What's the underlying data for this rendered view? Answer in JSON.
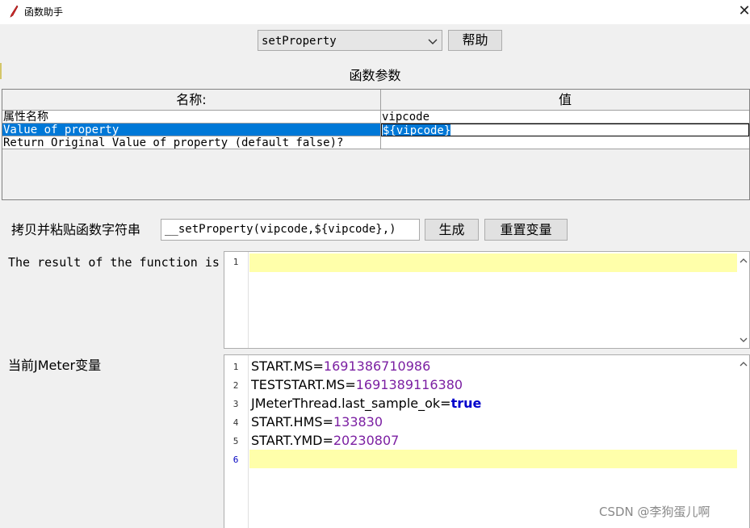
{
  "window": {
    "title": "函数助手",
    "app_icon": "feather-pen-icon",
    "close_icon": "close-icon"
  },
  "function_select": {
    "value": "setProperty",
    "arrow_icon": "chevron-down-icon"
  },
  "help_button": "帮助",
  "params_label": "函数参数",
  "table": {
    "headers": [
      "名称:",
      "值"
    ],
    "rows": [
      {
        "name": "属性名称",
        "value": "vipcode"
      },
      {
        "name": "Value of property",
        "value": "${vipcode}"
      },
      {
        "name": "Return Original Value of property (default false)?",
        "value": ""
      }
    ],
    "selected_row": 1
  },
  "copy_paste": {
    "label": "拷贝并粘贴函数字符串",
    "function_string": "__setProperty(vipcode,${vipcode},)",
    "generate_button": "生成",
    "reset_button": "重置变量"
  },
  "result": {
    "label": "The result of the function is",
    "line_numbers": [
      "1"
    ]
  },
  "variables": {
    "label": "当前JMeter变量",
    "line_numbers": [
      "1",
      "2",
      "3",
      "4",
      "5",
      "6"
    ],
    "lines": [
      {
        "key": "START.MS=",
        "value": "1691386710986"
      },
      {
        "key": "TESTSTART.MS=",
        "value": "1691389116380"
      },
      {
        "key": "JMeterThread.last_sample_ok=",
        "value": "true"
      },
      {
        "key": "START.HMS=",
        "value": "133830"
      },
      {
        "key": "START.YMD=",
        "value": "20230807"
      }
    ]
  },
  "watermark": "CSDN @李狗蛋儿啊",
  "colors": {
    "selection": "#0078d7",
    "current_line": "#ffffaa",
    "number": "#7b1fa2",
    "keyword": "#0000cc"
  }
}
